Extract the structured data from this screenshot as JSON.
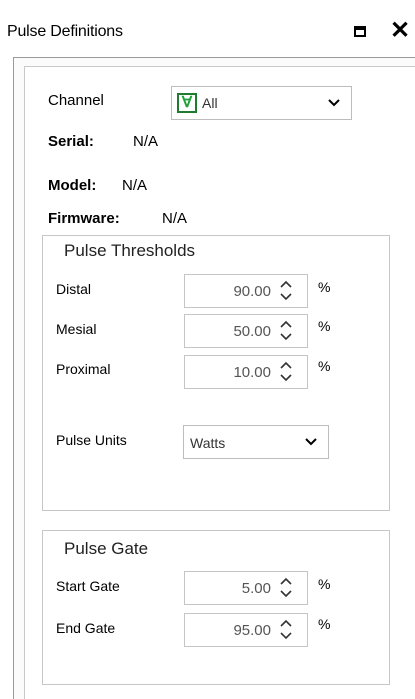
{
  "window": {
    "title": "Pulse Definitions",
    "maximize_icon": "maximize-icon",
    "close_glyph": "✕"
  },
  "channel": {
    "label": "Channel",
    "icon_glyph": "∀",
    "value": "All"
  },
  "info": {
    "serial_label": "Serial:",
    "serial_value": "N/A",
    "model_label": "Model:",
    "model_value": "N/A",
    "firmware_label": "Firmware:",
    "firmware_value": "N/A"
  },
  "thresholds": {
    "title": "Pulse Thresholds",
    "rows": [
      {
        "label": "Distal",
        "value": "90.00",
        "unit": "%"
      },
      {
        "label": "Mesial",
        "value": "50.00",
        "unit": "%"
      },
      {
        "label": "Proximal",
        "value": "10.00",
        "unit": "%"
      }
    ],
    "units_label": "Pulse Units",
    "units_value": "Watts"
  },
  "gate": {
    "title": "Pulse Gate",
    "rows": [
      {
        "label": "Start Gate",
        "value": "5.00",
        "unit": "%"
      },
      {
        "label": "End Gate",
        "value": "95.00",
        "unit": "%"
      }
    ]
  },
  "colors": {
    "accent_green": "#1fa23a",
    "border": "#c6c6c6"
  }
}
